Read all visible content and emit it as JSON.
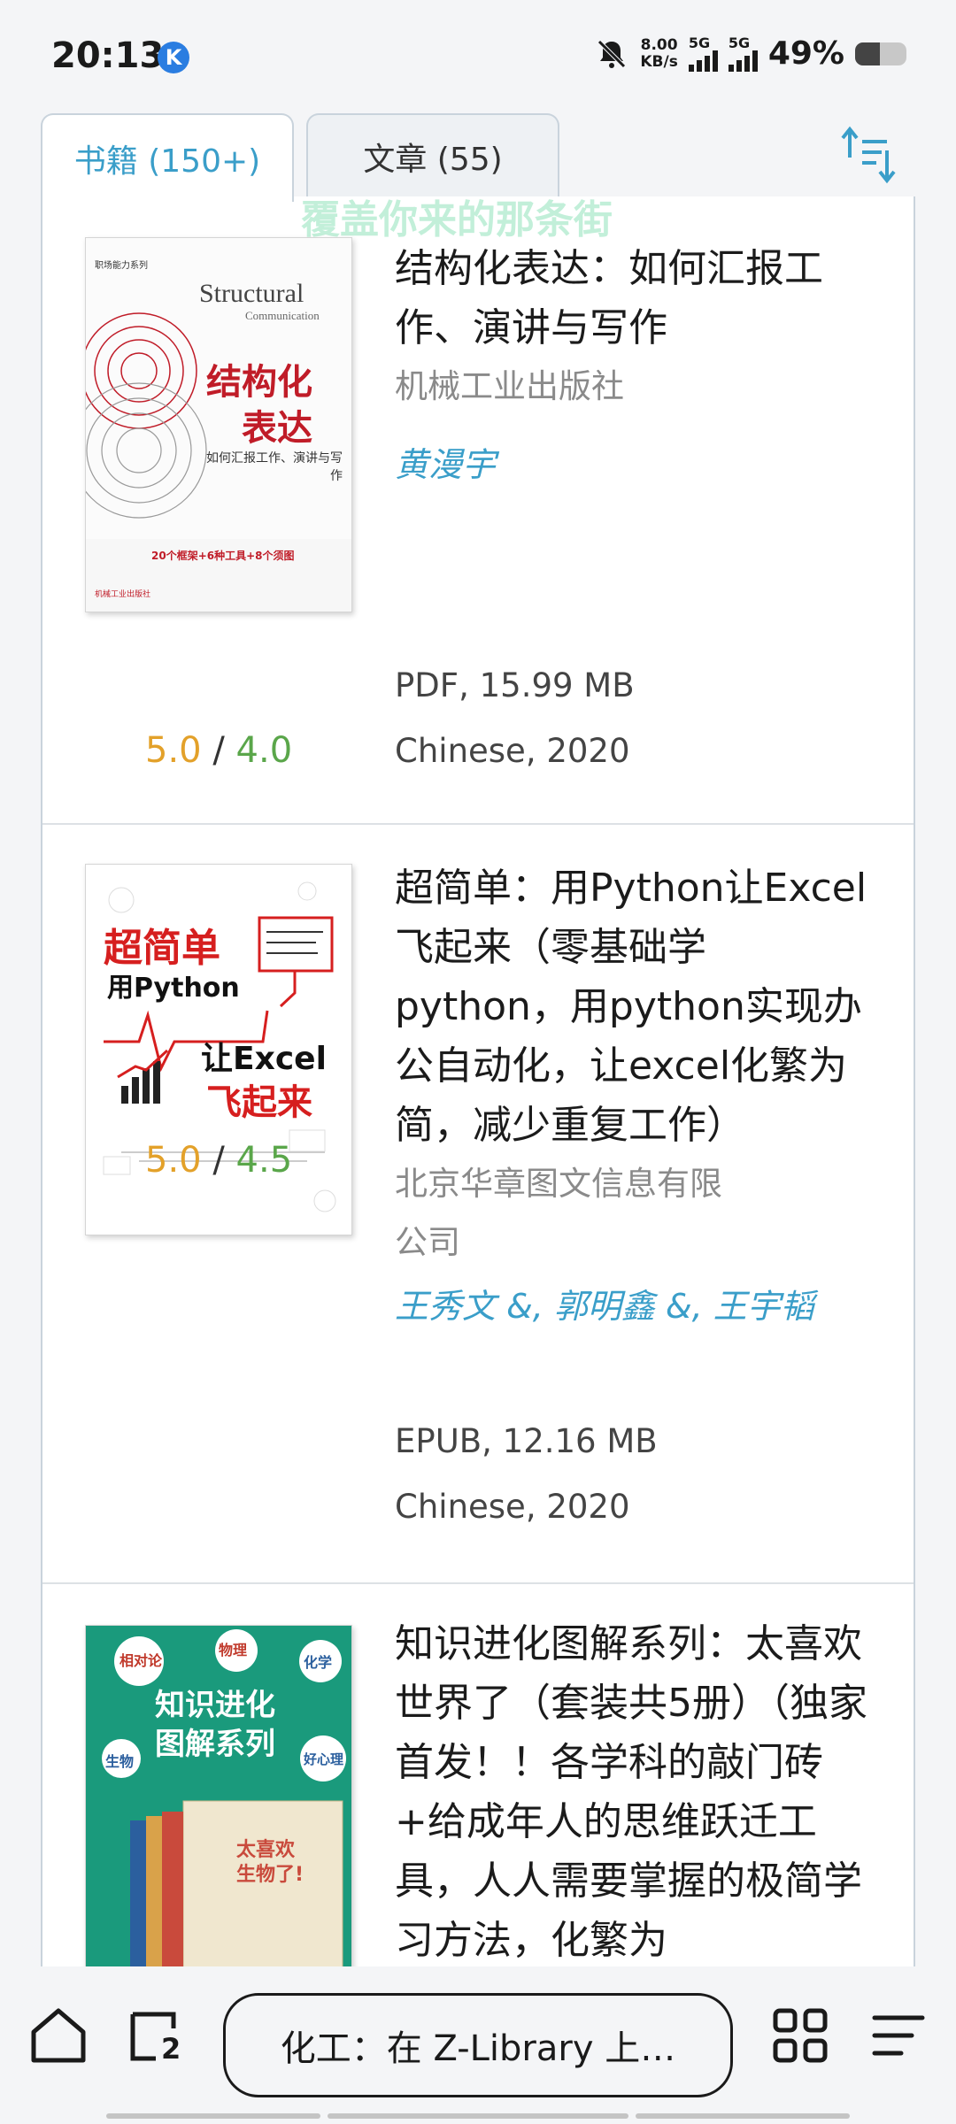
{
  "status_bar": {
    "time": "20:13",
    "app_badge": "K",
    "net_speed_value": "8.00",
    "net_speed_unit": "KB/s",
    "sim1_label": "5G",
    "sim2_label": "5G",
    "battery_percent": "49%",
    "battery_level": 0.49
  },
  "tabs": {
    "books": "书籍 (150+)",
    "articles": "文章 (55)"
  },
  "watermark": "覆盖你来的那条街",
  "books": [
    {
      "title": "结构化表达：如何汇报工作、演讲与写作",
      "publisher": "机械工业出版社",
      "author": "黄漫宇",
      "rating_a": "5.0",
      "rating_sep": "/",
      "rating_b": "4.0",
      "format": "PDF, 15.99 MB",
      "language_year": "Chinese, 2020",
      "cover": {
        "series": "职场能力系列",
        "title_en": "Structural",
        "subtitle_en": "Communication",
        "title_cn_1": "结构化",
        "title_cn_2": "表达",
        "subtitle_cn": "如何汇报工作、演讲与写作",
        "banner": "20个框架+6种工具+8个须图",
        "publisher_mark": "机械工业出版社"
      }
    },
    {
      "title": "超简单：用Python让Excel飞起来（零基础学python，用python实现办公自动化，让excel化繁为简，减少重复工作）",
      "publisher": "北京华章图文信息有限公司",
      "author": "王秀文 &, 郭明鑫 &, 王宇韬",
      "rating_a": "5.0",
      "rating_sep": "/",
      "rating_b": "4.5",
      "format": "EPUB, 12.16 MB",
      "language_year": "Chinese, 2020",
      "cover": {
        "line1": "超简单",
        "line2": "用Python",
        "line3": "让Excel",
        "line4": "飞起来"
      }
    },
    {
      "title": "知识进化图解系列：太喜欢世界了（套装共5册）（独家首发！！各学科的敲门砖+给成年人的思维跃迁工具，人人需要掌握的极简学习方法，化繁为",
      "cover": {
        "line1": "知识进化",
        "line2": "图解系列",
        "tag1": "相对论",
        "tag2": "物理",
        "tag3": "化学",
        "tag4": "生物",
        "tag5": "好心理",
        "book_title": "太喜欢生物了!"
      }
    }
  ],
  "bottom_nav": {
    "tab_count": "2",
    "search_text": "化工：在 Z-Library 上…"
  },
  "colors": {
    "accent": "#3a9ec9",
    "rating_primary": "#e3a12a",
    "rating_secondary": "#5aa64a"
  },
  "icons": {
    "home": "home-icon",
    "tabs": "tabs-icon",
    "apps": "grid-icon",
    "menu": "menu-icon",
    "sort": "sort-icon",
    "mute": "bell-off-icon"
  }
}
